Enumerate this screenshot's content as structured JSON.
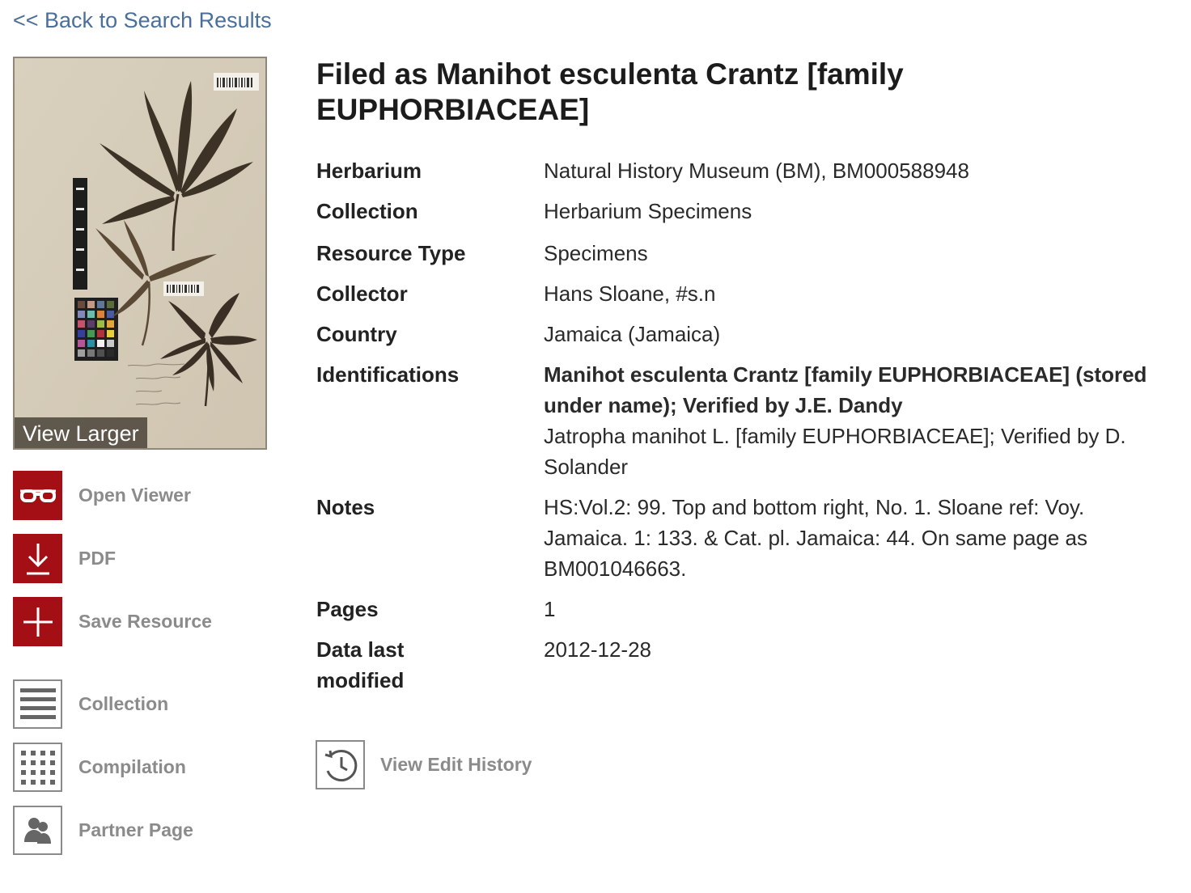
{
  "nav": {
    "back_label": "<< Back to Search Results"
  },
  "thumbnail": {
    "overlay_label": "View Larger"
  },
  "actions": [
    {
      "label": "Open Viewer",
      "icon": "glasses-icon"
    },
    {
      "label": "PDF",
      "icon": "download-icon"
    },
    {
      "label": "Save Resource",
      "icon": "plus-icon"
    },
    {
      "label": "Collection",
      "icon": "list-icon"
    },
    {
      "label": "Compilation",
      "icon": "grid-icon"
    },
    {
      "label": "Partner Page",
      "icon": "people-icon"
    }
  ],
  "title": "Filed as Manihot esculenta Crantz [family EUPHORBIACEAE]",
  "details": {
    "herbarium": {
      "label": "Herbarium",
      "value": "Natural History Museum (BM), BM000588948"
    },
    "collection": {
      "label": "Collection",
      "value": "Herbarium Specimens"
    },
    "resource_type": {
      "label": "Resource Type",
      "value": "Specimens"
    },
    "collector": {
      "label": "Collector",
      "value": "Hans Sloane, #s.n"
    },
    "country": {
      "label": "Country",
      "value": "Jamaica (Jamaica)"
    },
    "identifications": {
      "label": "Identifications",
      "primary": "Manihot esculenta Crantz [family EUPHORBIACEAE] (stored under name); Verified by J.E. Dandy",
      "secondary": "Jatropha manihot L. [family EUPHORBIACEAE]; Verified by D. Solander"
    },
    "notes": {
      "label": "Notes",
      "value": "HS:Vol.2: 99. Top and bottom right, No. 1. Sloane ref: Voy. Jamaica. 1: 133. & Cat. pl. Jamaica: 44. On same page as BM001046663."
    },
    "pages": {
      "label": "Pages",
      "value": "1"
    },
    "modified": {
      "label": "Data last modified",
      "value": "2012-12-28"
    }
  },
  "history": {
    "label": "View Edit History",
    "icon": "history-icon"
  },
  "colors": {
    "accent_red": "#a30f14",
    "link_blue": "#4a6f9a",
    "muted_grey": "#8b8b8b"
  }
}
